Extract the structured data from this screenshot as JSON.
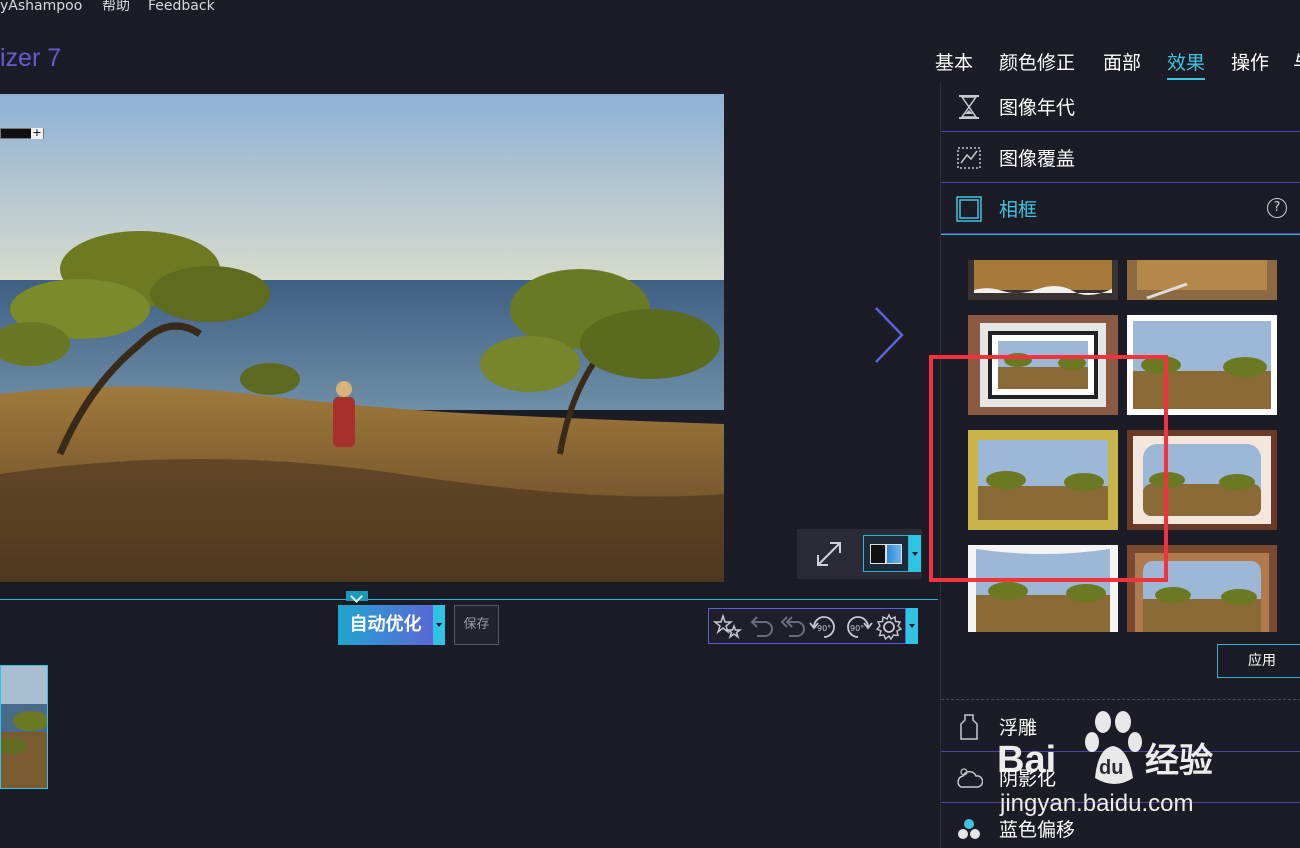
{
  "menu": {
    "items": [
      "yAshampoo",
      "帮助",
      "Feedback"
    ]
  },
  "app": {
    "title": "izer 7"
  },
  "tabs": [
    {
      "label": "基本",
      "active": false
    },
    {
      "label": "颜色修正",
      "active": false
    },
    {
      "label": "面部",
      "active": false
    },
    {
      "label": "效果",
      "active": true
    },
    {
      "label": "操作",
      "active": false
    },
    {
      "label": "与",
      "active": false
    }
  ],
  "toolbar": {
    "auto_optimize": "自动优化",
    "save": "保存"
  },
  "edit_tools": [
    "wand-stars-icon",
    "undo-icon",
    "undo-all-icon",
    "rotate-left-90-icon",
    "rotate-right-90-icon",
    "gear-icon"
  ],
  "edit_tools_text": {
    "rot": "90°"
  },
  "panel": {
    "sections": [
      {
        "label": "图像年代",
        "icon": "hourglass-icon",
        "active": false
      },
      {
        "label": "图像覆盖",
        "icon": "image-overlay-icon",
        "active": false
      },
      {
        "label": "相框",
        "icon": "frame-icon",
        "active": true
      },
      {
        "label": "浮雕",
        "icon": "emboss-icon",
        "active": false
      },
      {
        "label": "阴影化",
        "icon": "shadow-cloud-icon",
        "active": false
      },
      {
        "label": "蓝色偏移",
        "icon": "blue-shift-icon",
        "active": false
      }
    ],
    "help": "?",
    "apply": "应用",
    "frame_styles": [
      "torn-edge",
      "wooden-board",
      "brick-matte",
      "white-border",
      "gold-grunge",
      "vignette-ornate",
      "curled-paper",
      "carved-wood"
    ]
  },
  "colors": {
    "accent": "#3ec4e0",
    "brand": "#6a5ad2",
    "highlight": "#f2323c",
    "background": "#1b1c26"
  },
  "watermark": {
    "brand": "Baidu经验",
    "url": "jingyan.baidu.com"
  }
}
